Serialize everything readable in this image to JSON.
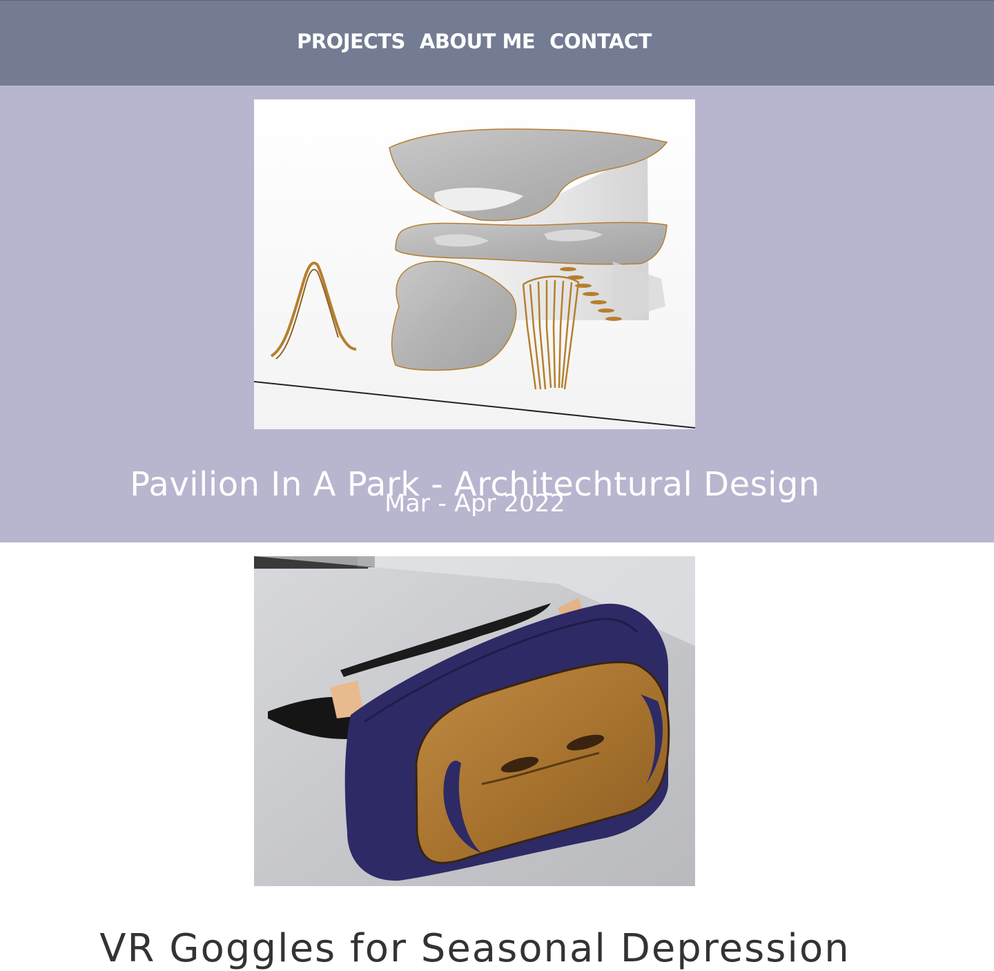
{
  "nav": {
    "items": [
      "PROJECTS",
      "ABOUT ME",
      "CONTACT"
    ]
  },
  "projects": [
    {
      "title": "Pavilion In A Park - Architechtural Design",
      "date": "Mar - Apr 2022",
      "image_alt": "Rendered model of a sculptural concrete pavilion with timber accents"
    },
    {
      "title": "VR Goggles for Seasonal Depression",
      "image_alt": "Photo of a VR goggles prototype with bamboo face plate and navy fabric"
    }
  ],
  "colors": {
    "header_bg": "#737c93",
    "project_band_bg": "#b8b5cf",
    "nav_text": "#ffffff",
    "title_text_on_band": "#ffffff",
    "title_text_on_white": "#333333"
  }
}
